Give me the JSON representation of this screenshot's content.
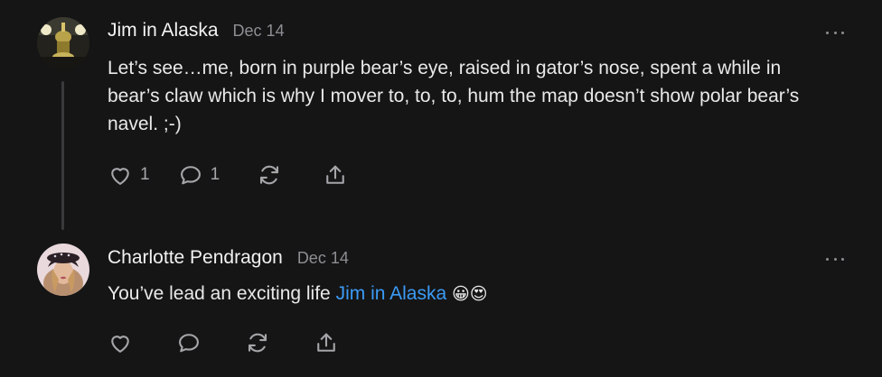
{
  "comments": [
    {
      "author": "Jim in Alaska",
      "date": "Dec 14",
      "text": "Let’s see…me, born in purple bear’s eye, raised in gator’s nose, spent a while in bear’s claw which is why I mover to, to, to, hum the map doesn’t show polar bear’s navel. ;-)",
      "likes": "1",
      "replies": "1"
    },
    {
      "author": "Charlotte Pendragon",
      "date": "Dec 14",
      "text_before": "You’ve lead an exciting life ",
      "mention": "Jim in Alaska",
      "emoji": "😀😍"
    }
  ],
  "icons": {
    "like": "heart-icon",
    "reply": "speech-bubble-icon",
    "restack": "restack-arrows-icon",
    "share": "share-upload-icon",
    "more": "more-dots-icon"
  },
  "colors": {
    "background": "#151516",
    "text": "#e9e9ea",
    "muted": "#8e8e93",
    "mention": "#3b9bf5",
    "thread_line": "#3a3a3c"
  }
}
